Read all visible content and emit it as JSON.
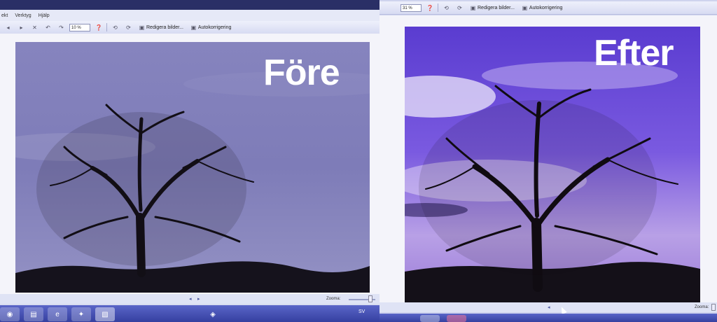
{
  "before": {
    "menu": [
      "ekt",
      "Verktyg",
      "Hjälp"
    ],
    "zoom_value": "10 %",
    "edit_label": "Redigera bilder...",
    "autocorrect_label": "Autokorrigering",
    "overlay_label": "Före",
    "zoom_label": "Zooma:",
    "lang": "SV"
  },
  "after": {
    "zoom_value": "31 %",
    "edit_label": "Redigera bilder...",
    "autocorrect_label": "Autokorrigering",
    "overlay_label": "Efter",
    "zoom_label": "Zooma:"
  },
  "icons": [
    "back-icon",
    "forward-icon",
    "delete-icon",
    "rotate-left-icon",
    "rotate-right-icon",
    "help-icon",
    "edit-icon",
    "autocorrect-icon"
  ],
  "colors": {
    "toolbar": "#e6e9f7",
    "taskbar": "#3540a0",
    "sky_before": "#7a78b4",
    "sky_after": "#6a48d8"
  }
}
